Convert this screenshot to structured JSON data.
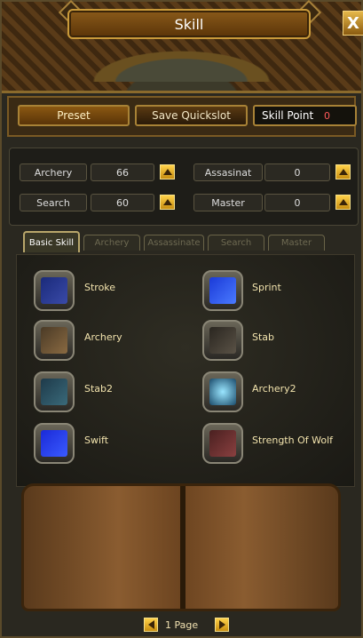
{
  "window": {
    "title": "Skill",
    "close_label": "X"
  },
  "toolbar": {
    "preset_label": "Preset",
    "save_quickslot_label": "Save Quickslot",
    "skill_point_label": "Skill Point",
    "skill_point_value": "0"
  },
  "stats": [
    {
      "label": "Archery",
      "value": "66"
    },
    {
      "label": "Assasinat",
      "value": "0"
    },
    {
      "label": "Search",
      "value": "60"
    },
    {
      "label": "Master",
      "value": "0"
    }
  ],
  "tabs": [
    {
      "label": "Basic Skill",
      "active": true
    },
    {
      "label": "Archery",
      "active": false
    },
    {
      "label": "Assassinate",
      "active": false
    },
    {
      "label": "Search",
      "active": false
    },
    {
      "label": "Master",
      "active": false
    }
  ],
  "skills": [
    {
      "name": "Stroke",
      "icon": "sword-icon"
    },
    {
      "name": "Sprint",
      "icon": "running-man-icon"
    },
    {
      "name": "Archery",
      "icon": "crossed-arrows-icon"
    },
    {
      "name": "Stab",
      "icon": "dagger-icon"
    },
    {
      "name": "Stab2",
      "icon": "spear-icon"
    },
    {
      "name": "Archery2",
      "icon": "glowing-arrows-icon"
    },
    {
      "name": "Swift",
      "icon": "swift-figure-icon"
    },
    {
      "name": "Strength Of Wolf",
      "icon": "wolf-icon"
    }
  ],
  "pager": {
    "text": "1 Page"
  },
  "colors": {
    "accent_gold": "#c99a3a",
    "skill_point_value": "#ff5a5a",
    "skill_text": "#f2e3ad"
  }
}
